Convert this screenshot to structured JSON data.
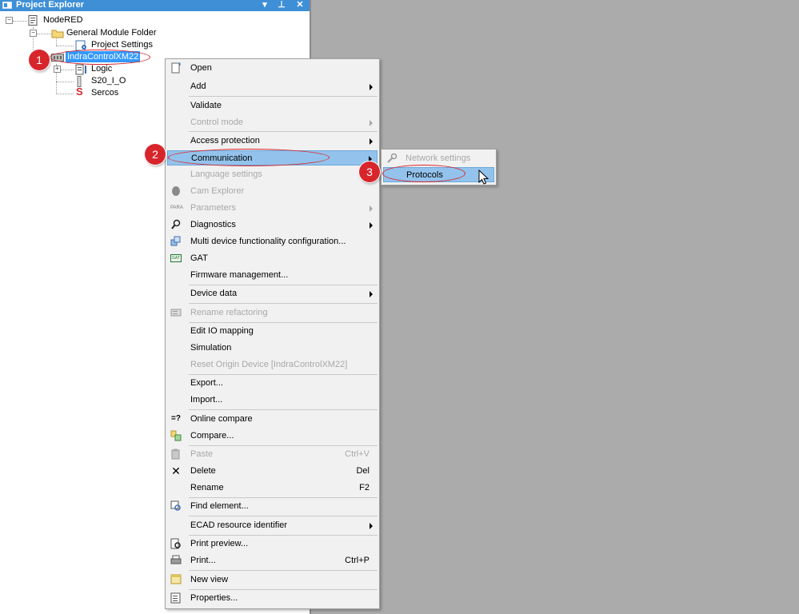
{
  "panel": {
    "title": "Project Explorer",
    "dropdown_glyph": "▾",
    "pin_glyph": "⊥",
    "close_glyph": "✕"
  },
  "tree": {
    "root": "NodeRED",
    "general_module_folder": "General Module Folder",
    "project_settings": "Project Settings",
    "device": "IndraControlXM22",
    "logic": "Logic",
    "io": "S20_I_O",
    "sercos": "Sercos",
    "sercos_icon_glyph": "S"
  },
  "badges": {
    "one": "1",
    "two": "2",
    "three": "3"
  },
  "context_menu": {
    "items": [
      {
        "label": "Open",
        "shortcut": "",
        "disabled": false,
        "submenu": false
      },
      {
        "label": "Add",
        "shortcut": "",
        "disabled": false,
        "submenu": true
      },
      {
        "label": "Validate",
        "shortcut": "",
        "disabled": false,
        "submenu": false
      },
      {
        "label": "Control mode",
        "shortcut": "",
        "disabled": true,
        "submenu": true
      },
      {
        "label": "Access protection",
        "shortcut": "",
        "disabled": false,
        "submenu": true
      },
      {
        "label": "Communication",
        "shortcut": "",
        "disabled": false,
        "submenu": true,
        "highlighted": true
      },
      {
        "label": "Language settings",
        "shortcut": "",
        "disabled": true,
        "submenu": false
      },
      {
        "label": "Cam Explorer",
        "shortcut": "",
        "disabled": true,
        "submenu": false
      },
      {
        "label": "Parameters",
        "shortcut": "",
        "disabled": true,
        "submenu": true
      },
      {
        "label": "Diagnostics",
        "shortcut": "",
        "disabled": false,
        "submenu": true
      },
      {
        "label": "Multi device functionality configuration...",
        "shortcut": "",
        "disabled": false,
        "submenu": false
      },
      {
        "label": "GAT",
        "shortcut": "",
        "disabled": false,
        "submenu": false
      },
      {
        "label": "Firmware management...",
        "shortcut": "",
        "disabled": false,
        "submenu": false
      },
      {
        "label": "Device data",
        "shortcut": "",
        "disabled": false,
        "submenu": true
      },
      {
        "label": "Rename refactoring",
        "shortcut": "",
        "disabled": true,
        "submenu": false
      },
      {
        "label": "Edit IO mapping",
        "shortcut": "",
        "disabled": false,
        "submenu": false
      },
      {
        "label": "Simulation",
        "shortcut": "",
        "disabled": false,
        "submenu": false
      },
      {
        "label": "Reset Origin Device [IndraControlXM22]",
        "shortcut": "",
        "disabled": true,
        "submenu": false
      },
      {
        "label": "Export...",
        "shortcut": "",
        "disabled": false,
        "submenu": false
      },
      {
        "label": "Import...",
        "shortcut": "",
        "disabled": false,
        "submenu": false
      },
      {
        "label": "Online compare",
        "shortcut": "",
        "disabled": false,
        "submenu": false
      },
      {
        "label": "Compare...",
        "shortcut": "",
        "disabled": false,
        "submenu": false
      },
      {
        "label": "Paste",
        "shortcut": "Ctrl+V",
        "disabled": true,
        "submenu": false
      },
      {
        "label": "Delete",
        "shortcut": "Del",
        "disabled": false,
        "submenu": false
      },
      {
        "label": "Rename",
        "shortcut": "F2",
        "disabled": false,
        "submenu": false
      },
      {
        "label": "Find element...",
        "shortcut": "",
        "disabled": false,
        "submenu": false
      },
      {
        "label": "ECAD resource identifier",
        "shortcut": "",
        "disabled": false,
        "submenu": true
      },
      {
        "label": "Print preview...",
        "shortcut": "",
        "disabled": false,
        "submenu": false
      },
      {
        "label": "Print...",
        "shortcut": "Ctrl+P",
        "disabled": false,
        "submenu": false
      },
      {
        "label": "New view",
        "shortcut": "",
        "disabled": false,
        "submenu": false
      },
      {
        "label": "Properties...",
        "shortcut": "",
        "disabled": false,
        "submenu": false
      }
    ],
    "icons": {
      "gat_glyph": "GAT",
      "para_glyph": "PARA",
      "online_compare_glyph": "=?"
    }
  },
  "submenu": {
    "items": [
      {
        "label": "Network settings",
        "disabled": true
      },
      {
        "label": "Protocols",
        "disabled": false,
        "highlighted": true
      }
    ]
  },
  "colors": {
    "titlebar": "#3e8fd6",
    "highlight": "#93c3ec",
    "annotation_red": "#d8252c",
    "selection": "#3399ff",
    "background": "#ababab"
  }
}
